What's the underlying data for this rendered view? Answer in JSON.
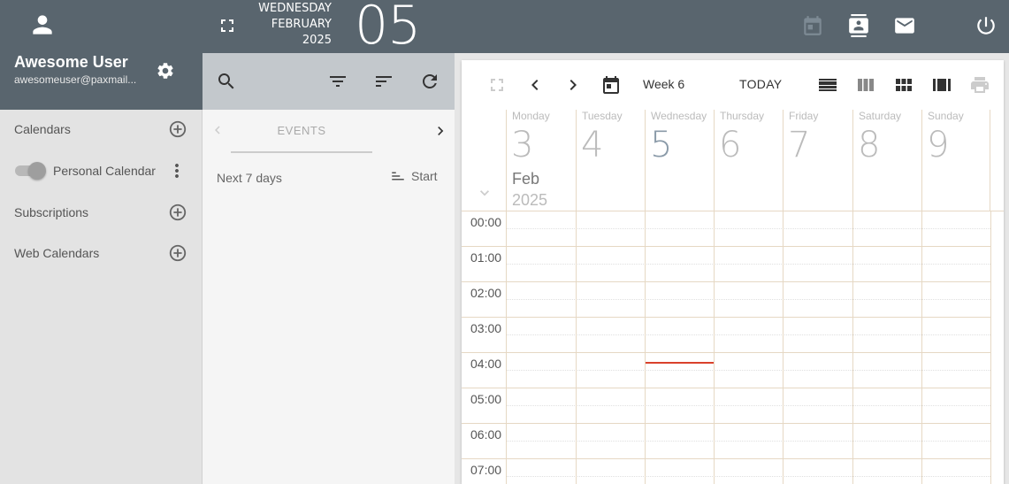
{
  "header": {
    "weekday": "WEDNESDAY",
    "month": "FEBRUARY",
    "year": "2025",
    "day": "05"
  },
  "user": {
    "name": "Awesome User",
    "email": "awesomeuser@paxmail..."
  },
  "sidebar": {
    "items": [
      {
        "label": "Calendars"
      },
      {
        "label": "Personal Calendar"
      },
      {
        "label": "Subscriptions"
      },
      {
        "label": "Web Calendars"
      }
    ]
  },
  "events_panel": {
    "tab_label": "EVENTS",
    "range_label": "Next 7 days",
    "sort_label": "Start"
  },
  "calendar": {
    "week_label": "Week 6",
    "today_label": "TODAY",
    "month_short": "Feb",
    "year": "2025",
    "days": [
      {
        "name": "Monday",
        "num": "3"
      },
      {
        "name": "Tuesday",
        "num": "4"
      },
      {
        "name": "Wednesday",
        "num": "5"
      },
      {
        "name": "Thursday",
        "num": "6"
      },
      {
        "name": "Friday",
        "num": "7"
      },
      {
        "name": "Saturday",
        "num": "8"
      },
      {
        "name": "Sunday",
        "num": "9"
      }
    ],
    "hours": [
      "00:00",
      "01:00",
      "02:00",
      "03:00",
      "04:00",
      "05:00",
      "06:00",
      "07:00"
    ]
  },
  "colors": {
    "header_bg": "#59656e",
    "grid_line": "#e6d8c4",
    "now_line": "#d9412b"
  }
}
